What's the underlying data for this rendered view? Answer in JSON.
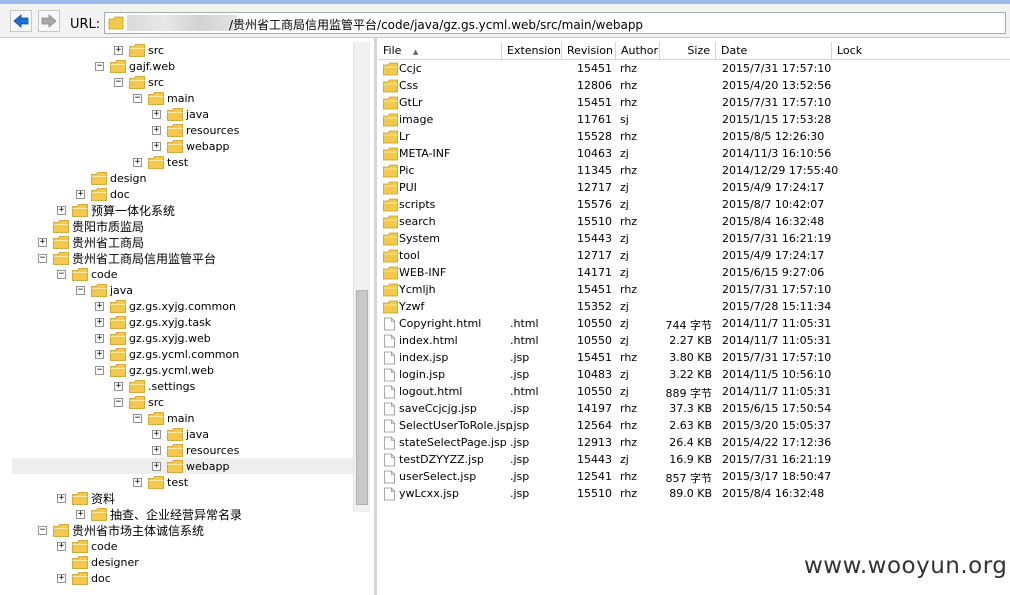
{
  "toolbar": {
    "back_icon": "back-arrow-icon",
    "forward_icon": "forward-arrow-icon",
    "url_label": "URL:",
    "url_path": "/贵州省工商局信用监管平台/code/java/gz.gs.ycml.web/src/main/webapp"
  },
  "colors": {
    "accent": "#1a6fd6",
    "folder": "#f2c94c",
    "selection": "#eeeeee"
  },
  "tree": [
    {
      "label": "src",
      "level": 5,
      "expander": "+"
    },
    {
      "label": "gajf.web",
      "level": 4,
      "expander": "-"
    },
    {
      "label": "src",
      "level": 5,
      "expander": "-"
    },
    {
      "label": "main",
      "level": 6,
      "expander": "-"
    },
    {
      "label": "java",
      "level": 7,
      "expander": "+"
    },
    {
      "label": "resources",
      "level": 7,
      "expander": "+"
    },
    {
      "label": "webapp",
      "level": 7,
      "expander": "+"
    },
    {
      "label": "test",
      "level": 6,
      "expander": "+"
    },
    {
      "label": "design",
      "level": 3,
      "expander": ""
    },
    {
      "label": "doc",
      "level": 3,
      "expander": "+"
    },
    {
      "label": "预算一体化系统",
      "level": 2,
      "expander": "+"
    },
    {
      "label": "贵阳市质监局",
      "level": 1,
      "expander": ""
    },
    {
      "label": "贵州省工商局",
      "level": 1,
      "expander": "+"
    },
    {
      "label": "贵州省工商局信用监管平台",
      "level": 1,
      "expander": "-"
    },
    {
      "label": "code",
      "level": 2,
      "expander": "-"
    },
    {
      "label": "java",
      "level": 3,
      "expander": "-"
    },
    {
      "label": "gz.gs.xyjg.common",
      "level": 4,
      "expander": "+"
    },
    {
      "label": "gz.gs.xyjg.task",
      "level": 4,
      "expander": "+"
    },
    {
      "label": "gz.gs.xyjg.web",
      "level": 4,
      "expander": "+"
    },
    {
      "label": "gz.gs.ycml.common",
      "level": 4,
      "expander": "+"
    },
    {
      "label": "gz.gs.ycml.web",
      "level": 4,
      "expander": "-"
    },
    {
      "label": ".settings",
      "level": 5,
      "expander": "+"
    },
    {
      "label": "src",
      "level": 5,
      "expander": "-"
    },
    {
      "label": "main",
      "level": 6,
      "expander": "-"
    },
    {
      "label": "java",
      "level": 7,
      "expander": "+"
    },
    {
      "label": "resources",
      "level": 7,
      "expander": "+"
    },
    {
      "label": "webapp",
      "level": 7,
      "expander": "+",
      "selected": true
    },
    {
      "label": "test",
      "level": 6,
      "expander": "+"
    },
    {
      "label": "资料",
      "level": 2,
      "expander": "+"
    },
    {
      "label": "抽查、企业经营异常名录",
      "level": 3,
      "expander": "+"
    },
    {
      "label": "贵州省市场主体诚信系统",
      "level": 1,
      "expander": "-"
    },
    {
      "label": "code",
      "level": 2,
      "expander": "+"
    },
    {
      "label": "designer",
      "level": 2,
      "expander": ""
    },
    {
      "label": "doc",
      "level": 2,
      "expander": "+"
    }
  ],
  "list": {
    "columns": [
      "File",
      "Extension",
      "Revision",
      "Author",
      "Size",
      "Date",
      "Lock"
    ],
    "sort_indicator": "▲",
    "files": [
      {
        "type": "folder",
        "name": "Ccjc",
        "ext": "",
        "rev": "15451",
        "author": "rhz",
        "size": "",
        "date": "2015/7/31 17:57:10"
      },
      {
        "type": "folder",
        "name": "Css",
        "ext": "",
        "rev": "12806",
        "author": "rhz",
        "size": "",
        "date": "2015/4/20 13:52:56"
      },
      {
        "type": "folder",
        "name": "GtLr",
        "ext": "",
        "rev": "15451",
        "author": "rhz",
        "size": "",
        "date": "2015/7/31 17:57:10"
      },
      {
        "type": "folder",
        "name": "image",
        "ext": "",
        "rev": "11761",
        "author": "sj",
        "size": "",
        "date": "2015/1/15 17:53:28"
      },
      {
        "type": "folder",
        "name": "Lr",
        "ext": "",
        "rev": "15528",
        "author": "rhz",
        "size": "",
        "date": "2015/8/5 12:26:30"
      },
      {
        "type": "folder",
        "name": "META-INF",
        "ext": "",
        "rev": "10463",
        "author": "zj",
        "size": "",
        "date": "2014/11/3 16:10:56"
      },
      {
        "type": "folder",
        "name": "Pic",
        "ext": "",
        "rev": "11345",
        "author": "rhz",
        "size": "",
        "date": "2014/12/29 17:55:40"
      },
      {
        "type": "folder",
        "name": "PUI",
        "ext": "",
        "rev": "12717",
        "author": "zj",
        "size": "",
        "date": "2015/4/9 17:24:17"
      },
      {
        "type": "folder",
        "name": "scripts",
        "ext": "",
        "rev": "15576",
        "author": "zj",
        "size": "",
        "date": "2015/8/7 10:42:07"
      },
      {
        "type": "folder",
        "name": "search",
        "ext": "",
        "rev": "15510",
        "author": "rhz",
        "size": "",
        "date": "2015/8/4 16:32:48"
      },
      {
        "type": "folder",
        "name": "System",
        "ext": "",
        "rev": "15443",
        "author": "zj",
        "size": "",
        "date": "2015/7/31 16:21:19"
      },
      {
        "type": "folder",
        "name": "tool",
        "ext": "",
        "rev": "12717",
        "author": "zj",
        "size": "",
        "date": "2015/4/9 17:24:17"
      },
      {
        "type": "folder",
        "name": "WEB-INF",
        "ext": "",
        "rev": "14171",
        "author": "zj",
        "size": "",
        "date": "2015/6/15 9:27:06"
      },
      {
        "type": "folder",
        "name": "Ycmljh",
        "ext": "",
        "rev": "15451",
        "author": "rhz",
        "size": "",
        "date": "2015/7/31 17:57:10"
      },
      {
        "type": "folder",
        "name": "Yzwf",
        "ext": "",
        "rev": "15352",
        "author": "zj",
        "size": "",
        "date": "2015/7/28 15:11:34"
      },
      {
        "type": "file",
        "name": "Copyright.html",
        "ext": ".html",
        "rev": "10550",
        "author": "zj",
        "size": "744 字节",
        "date": "2014/11/7 11:05:31"
      },
      {
        "type": "file",
        "name": "index.html",
        "ext": ".html",
        "rev": "10550",
        "author": "zj",
        "size": "2.27 KB",
        "date": "2014/11/7 11:05:31"
      },
      {
        "type": "file",
        "name": "index.jsp",
        "ext": ".jsp",
        "rev": "15451",
        "author": "rhz",
        "size": "3.80 KB",
        "date": "2015/7/31 17:57:10"
      },
      {
        "type": "file",
        "name": "login.jsp",
        "ext": ".jsp",
        "rev": "10483",
        "author": "zj",
        "size": "3.22 KB",
        "date": "2014/11/5 10:56:10"
      },
      {
        "type": "file",
        "name": "logout.html",
        "ext": ".html",
        "rev": "10550",
        "author": "zj",
        "size": "889 字节",
        "date": "2014/11/7 11:05:31"
      },
      {
        "type": "file",
        "name": "saveCcjcjg.jsp",
        "ext": ".jsp",
        "rev": "14197",
        "author": "rhz",
        "size": "37.3 KB",
        "date": "2015/6/15 17:50:54"
      },
      {
        "type": "file",
        "name": "SelectUserToRole.jsp",
        "ext": ".jsp",
        "rev": "12564",
        "author": "rhz",
        "size": "2.63 KB",
        "date": "2015/3/20 15:05:37"
      },
      {
        "type": "file",
        "name": "stateSelectPage.jsp",
        "ext": ".jsp",
        "rev": "12913",
        "author": "rhz",
        "size": "26.4 KB",
        "date": "2015/4/22 17:12:36"
      },
      {
        "type": "file",
        "name": "testDZYYZZ.jsp",
        "ext": ".jsp",
        "rev": "15443",
        "author": "zj",
        "size": "16.9 KB",
        "date": "2015/7/31 16:21:19"
      },
      {
        "type": "file",
        "name": "userSelect.jsp",
        "ext": ".jsp",
        "rev": "12541",
        "author": "rhz",
        "size": "857 字节",
        "date": "2015/3/17 18:50:47"
      },
      {
        "type": "file",
        "name": "ywLcxx.jsp",
        "ext": ".jsp",
        "rev": "15510",
        "author": "rhz",
        "size": "89.0 KB",
        "date": "2015/8/4 16:32:48"
      }
    ]
  },
  "watermark": "www.wooyun.org"
}
